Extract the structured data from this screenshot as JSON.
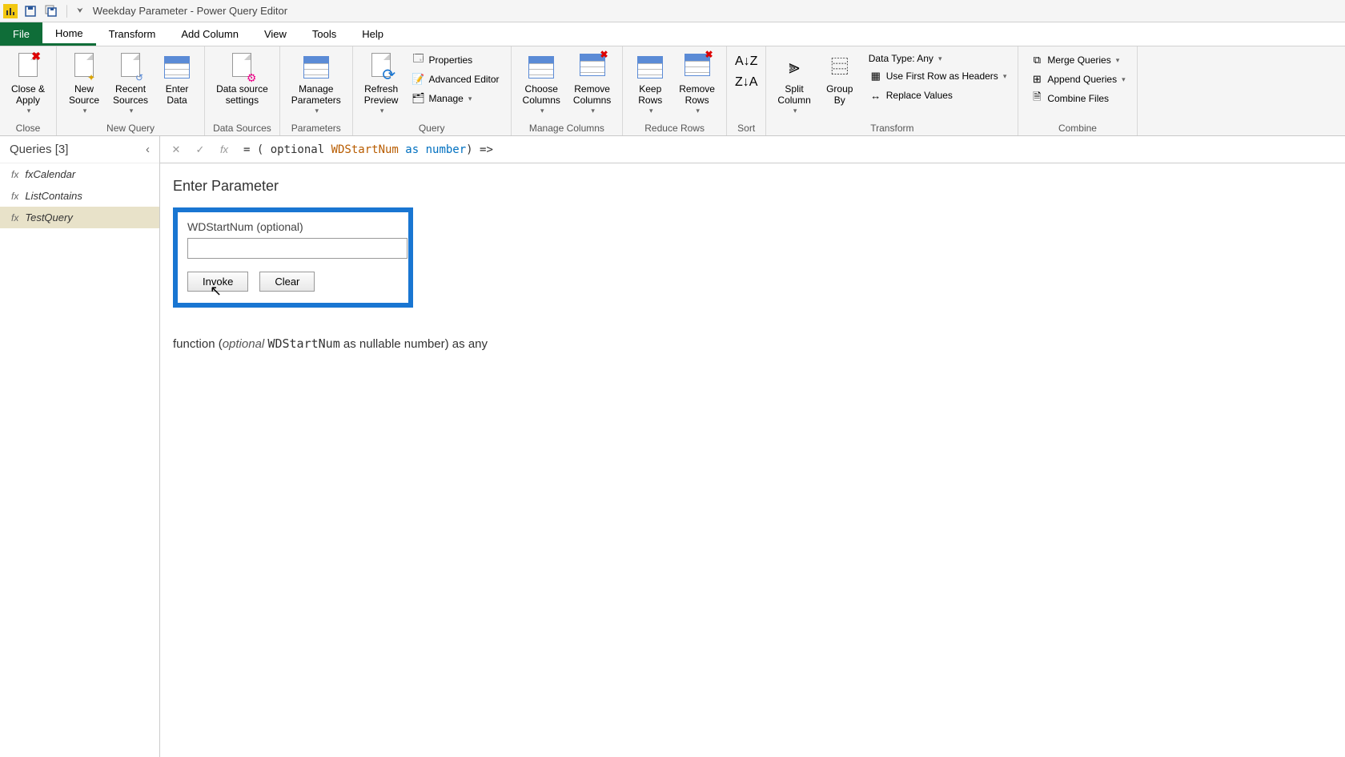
{
  "title": "Weekday Parameter - Power Query Editor",
  "tabs": {
    "file": "File",
    "home": "Home",
    "transform": "Transform",
    "addcol": "Add Column",
    "view": "View",
    "tools": "Tools",
    "help": "Help"
  },
  "ribbon": {
    "close": {
      "closeApply": "Close &\nApply",
      "group": "Close"
    },
    "newquery": {
      "newSource": "New\nSource",
      "recent": "Recent\nSources",
      "enterData": "Enter\nData",
      "group": "New Query"
    },
    "datasources": {
      "dss": "Data source\nsettings",
      "group": "Data Sources"
    },
    "parameters": {
      "manage": "Manage\nParameters",
      "group": "Parameters"
    },
    "query": {
      "refresh": "Refresh\nPreview",
      "props": "Properties",
      "adv": "Advanced Editor",
      "manage": "Manage",
      "group": "Query"
    },
    "managecols": {
      "choose": "Choose\nColumns",
      "remove": "Remove\nColumns",
      "group": "Manage Columns"
    },
    "reducerows": {
      "keep": "Keep\nRows",
      "remove": "Remove\nRows",
      "group": "Reduce Rows"
    },
    "sort": {
      "group": "Sort"
    },
    "transform": {
      "split": "Split\nColumn",
      "groupby": "Group\nBy",
      "datatype": "Data Type: Any",
      "firstrow": "Use First Row as Headers",
      "replace": "Replace Values",
      "group": "Transform"
    },
    "combine": {
      "merge": "Merge Queries",
      "append": "Append Queries",
      "combine": "Combine Files",
      "group": "Combine"
    }
  },
  "sidebar": {
    "title": "Queries [3]",
    "items": [
      {
        "label": "fxCalendar"
      },
      {
        "label": "ListContains"
      },
      {
        "label": "TestQuery"
      }
    ]
  },
  "formula": {
    "prefix": "= ( optional ",
    "ident": "WDStartNum",
    "mid": " as ",
    "kw": "number",
    "suffix": ") =>"
  },
  "paramPanel": {
    "heading": "Enter Parameter",
    "label": "WDStartNum (optional)",
    "value": "",
    "invoke": "Invoke",
    "clear": "Clear"
  },
  "signature": {
    "p1": "function (",
    "opt": "optional ",
    "name": "WDStartNum",
    "p2": " as nullable number) as any"
  }
}
